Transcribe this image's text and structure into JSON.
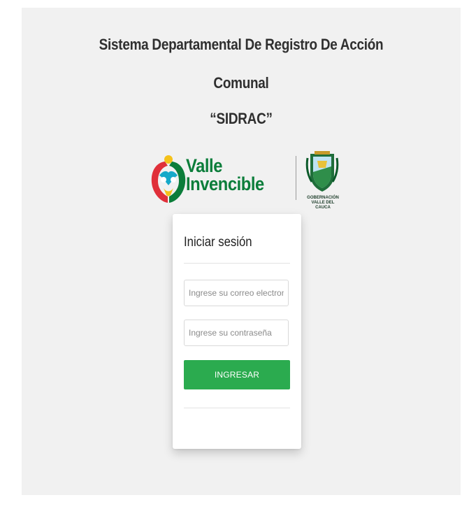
{
  "header": {
    "title_line1": "Sistema Departamental De Registro De Acción",
    "title_line2": "Comunal",
    "title_line3": "“SIDRAC”"
  },
  "logos": {
    "valle_line1": "Valle",
    "valle_line2": "Invencible",
    "gov_line1": "GOBERNACIÓN",
    "gov_line2": "VALLE DEL CAUCA",
    "brand_green": "#0b7d3a",
    "brand_red": "#e0303a",
    "brand_yellow": "#f5c21a",
    "brand_cyan": "#16a9c9"
  },
  "login": {
    "title": "Iniciar sesión",
    "email_placeholder": "Ingrese su correo electronico",
    "email_value": "",
    "password_placeholder": "Ingrese su contraseña",
    "password_value": "",
    "submit_label": "INGRESAR",
    "submit_color": "#2bab4f"
  }
}
